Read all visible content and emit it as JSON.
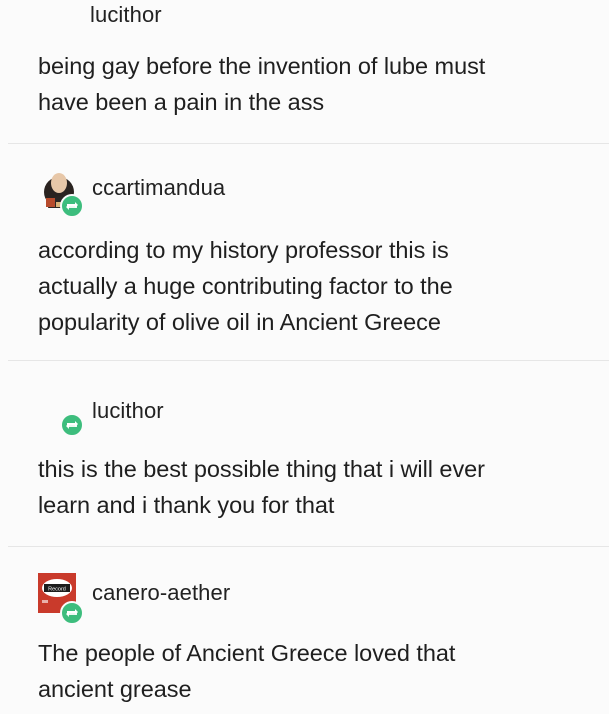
{
  "posts": [
    {
      "username": "lucithor",
      "text": "being gay before the invention of lube must\nhave been a pain in the ass",
      "avatar_icon": "none"
    },
    {
      "username": "ccartimandua",
      "text": "according to my history professor this is\nactually a huge contributing factor to the\npopularity of olive oil in Ancient Greece",
      "avatar_icon": "portrait-avatar",
      "badge_icon": "reblog-icon"
    },
    {
      "username": "lucithor",
      "text": "this is the best possible thing that i will ever\nlearn and i thank you for that",
      "avatar_icon": "none",
      "badge_icon": "reblog-icon"
    },
    {
      "username": "canero-aether",
      "text": "The people of Ancient Greece loved that\nancient grease",
      "avatar_icon": "record-avatar",
      "badge_icon": "reblog-icon",
      "avatar_label": "Record"
    }
  ],
  "colors": {
    "background": "#fbfbfb",
    "reblog_green": "#3dbd7d",
    "divider": "#e6e6e6"
  }
}
